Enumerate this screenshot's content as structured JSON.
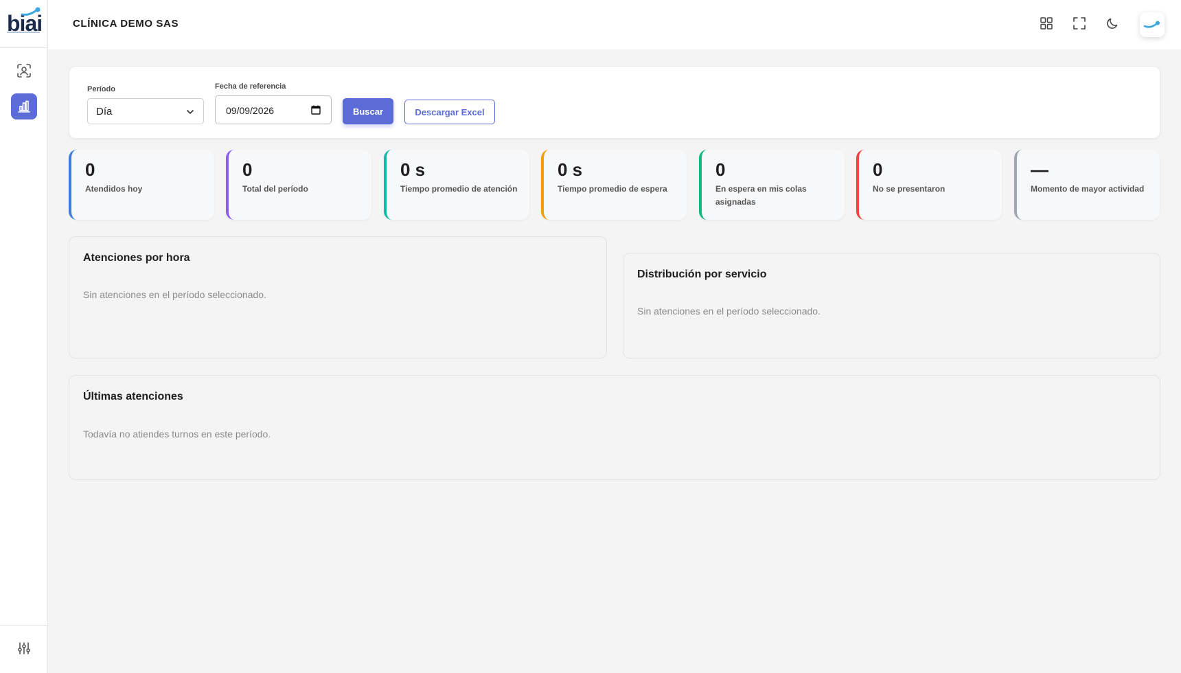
{
  "brand": {
    "logo_text": "biai",
    "accent_color": "#5b6bd8"
  },
  "sidebar": {
    "items": [
      {
        "icon": "face-scan-icon",
        "active": false
      },
      {
        "icon": "bar-chart-icon",
        "active": true
      }
    ],
    "bottom_icon": "sliders-icon"
  },
  "header": {
    "org_title": "CLÍNICA DEMO SAS",
    "icons": [
      "grid-icon",
      "fullscreen-icon",
      "moon-icon",
      "avatar"
    ]
  },
  "filters": {
    "period_label": "Período",
    "period_value": "Día",
    "reference_label": "Fecha de referencia",
    "reference_value": "09/09/2026",
    "search_label": "Buscar",
    "download_label": "Descargar Excel"
  },
  "stats": [
    {
      "value": "0",
      "label": "Atendidos hoy",
      "color": "#3b7ddd"
    },
    {
      "value": "0",
      "label": "Total del período",
      "color": "#8b5cf6"
    },
    {
      "value": "0 s",
      "label": "Tiempo promedio de atención",
      "color": "#14b8a6"
    },
    {
      "value": "0 s",
      "label": "Tiempo promedio de espera",
      "color": "#f59e0b"
    },
    {
      "value": "0",
      "label": "En espera en mis colas asignadas",
      "color": "#10b981"
    },
    {
      "value": "0",
      "label": "No se presentaron",
      "color": "#ef4444"
    },
    {
      "value": "—",
      "label": "Momento de mayor actividad",
      "color": "#a0a6b4"
    }
  ],
  "panels": {
    "hourly": {
      "title": "Atenciones por hora",
      "empty": "Sin atenciones en el período seleccionado."
    },
    "service": {
      "title": "Distribución por servicio",
      "empty": "Sin atenciones en el período seleccionado."
    },
    "latest": {
      "title": "Últimas atenciones",
      "empty": "Todavía no atiendes turnos en este período."
    }
  }
}
